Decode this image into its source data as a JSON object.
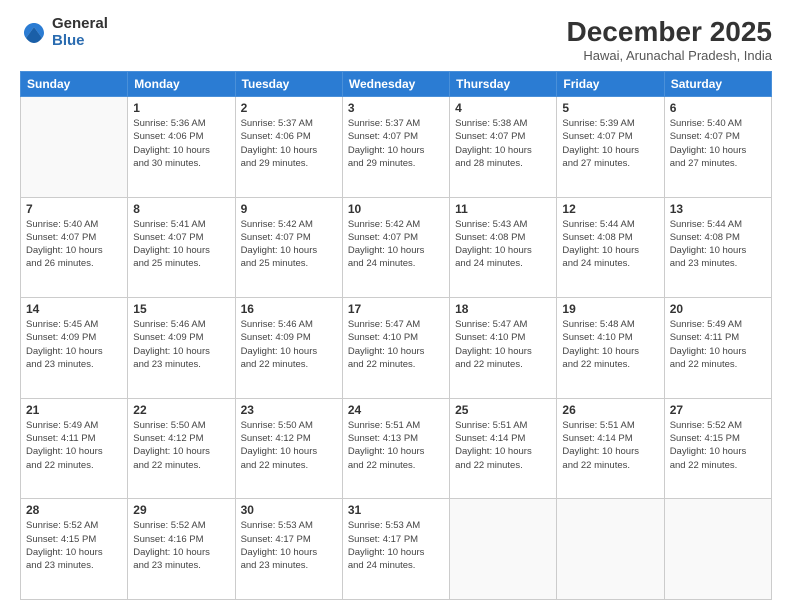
{
  "logo": {
    "general": "General",
    "blue": "Blue"
  },
  "title": "December 2025",
  "location": "Hawai, Arunachal Pradesh, India",
  "days_of_week": [
    "Sunday",
    "Monday",
    "Tuesday",
    "Wednesday",
    "Thursday",
    "Friday",
    "Saturday"
  ],
  "weeks": [
    [
      {
        "day": "",
        "info": ""
      },
      {
        "day": "1",
        "info": "Sunrise: 5:36 AM\nSunset: 4:06 PM\nDaylight: 10 hours\nand 30 minutes."
      },
      {
        "day": "2",
        "info": "Sunrise: 5:37 AM\nSunset: 4:06 PM\nDaylight: 10 hours\nand 29 minutes."
      },
      {
        "day": "3",
        "info": "Sunrise: 5:37 AM\nSunset: 4:07 PM\nDaylight: 10 hours\nand 29 minutes."
      },
      {
        "day": "4",
        "info": "Sunrise: 5:38 AM\nSunset: 4:07 PM\nDaylight: 10 hours\nand 28 minutes."
      },
      {
        "day": "5",
        "info": "Sunrise: 5:39 AM\nSunset: 4:07 PM\nDaylight: 10 hours\nand 27 minutes."
      },
      {
        "day": "6",
        "info": "Sunrise: 5:40 AM\nSunset: 4:07 PM\nDaylight: 10 hours\nand 27 minutes."
      }
    ],
    [
      {
        "day": "7",
        "info": "Sunrise: 5:40 AM\nSunset: 4:07 PM\nDaylight: 10 hours\nand 26 minutes."
      },
      {
        "day": "8",
        "info": "Sunrise: 5:41 AM\nSunset: 4:07 PM\nDaylight: 10 hours\nand 25 minutes."
      },
      {
        "day": "9",
        "info": "Sunrise: 5:42 AM\nSunset: 4:07 PM\nDaylight: 10 hours\nand 25 minutes."
      },
      {
        "day": "10",
        "info": "Sunrise: 5:42 AM\nSunset: 4:07 PM\nDaylight: 10 hours\nand 24 minutes."
      },
      {
        "day": "11",
        "info": "Sunrise: 5:43 AM\nSunset: 4:08 PM\nDaylight: 10 hours\nand 24 minutes."
      },
      {
        "day": "12",
        "info": "Sunrise: 5:44 AM\nSunset: 4:08 PM\nDaylight: 10 hours\nand 24 minutes."
      },
      {
        "day": "13",
        "info": "Sunrise: 5:44 AM\nSunset: 4:08 PM\nDaylight: 10 hours\nand 23 minutes."
      }
    ],
    [
      {
        "day": "14",
        "info": "Sunrise: 5:45 AM\nSunset: 4:09 PM\nDaylight: 10 hours\nand 23 minutes."
      },
      {
        "day": "15",
        "info": "Sunrise: 5:46 AM\nSunset: 4:09 PM\nDaylight: 10 hours\nand 23 minutes."
      },
      {
        "day": "16",
        "info": "Sunrise: 5:46 AM\nSunset: 4:09 PM\nDaylight: 10 hours\nand 22 minutes."
      },
      {
        "day": "17",
        "info": "Sunrise: 5:47 AM\nSunset: 4:10 PM\nDaylight: 10 hours\nand 22 minutes."
      },
      {
        "day": "18",
        "info": "Sunrise: 5:47 AM\nSunset: 4:10 PM\nDaylight: 10 hours\nand 22 minutes."
      },
      {
        "day": "19",
        "info": "Sunrise: 5:48 AM\nSunset: 4:10 PM\nDaylight: 10 hours\nand 22 minutes."
      },
      {
        "day": "20",
        "info": "Sunrise: 5:49 AM\nSunset: 4:11 PM\nDaylight: 10 hours\nand 22 minutes."
      }
    ],
    [
      {
        "day": "21",
        "info": "Sunrise: 5:49 AM\nSunset: 4:11 PM\nDaylight: 10 hours\nand 22 minutes."
      },
      {
        "day": "22",
        "info": "Sunrise: 5:50 AM\nSunset: 4:12 PM\nDaylight: 10 hours\nand 22 minutes."
      },
      {
        "day": "23",
        "info": "Sunrise: 5:50 AM\nSunset: 4:12 PM\nDaylight: 10 hours\nand 22 minutes."
      },
      {
        "day": "24",
        "info": "Sunrise: 5:51 AM\nSunset: 4:13 PM\nDaylight: 10 hours\nand 22 minutes."
      },
      {
        "day": "25",
        "info": "Sunrise: 5:51 AM\nSunset: 4:14 PM\nDaylight: 10 hours\nand 22 minutes."
      },
      {
        "day": "26",
        "info": "Sunrise: 5:51 AM\nSunset: 4:14 PM\nDaylight: 10 hours\nand 22 minutes."
      },
      {
        "day": "27",
        "info": "Sunrise: 5:52 AM\nSunset: 4:15 PM\nDaylight: 10 hours\nand 22 minutes."
      }
    ],
    [
      {
        "day": "28",
        "info": "Sunrise: 5:52 AM\nSunset: 4:15 PM\nDaylight: 10 hours\nand 23 minutes."
      },
      {
        "day": "29",
        "info": "Sunrise: 5:52 AM\nSunset: 4:16 PM\nDaylight: 10 hours\nand 23 minutes."
      },
      {
        "day": "30",
        "info": "Sunrise: 5:53 AM\nSunset: 4:17 PM\nDaylight: 10 hours\nand 23 minutes."
      },
      {
        "day": "31",
        "info": "Sunrise: 5:53 AM\nSunset: 4:17 PM\nDaylight: 10 hours\nand 24 minutes."
      },
      {
        "day": "",
        "info": ""
      },
      {
        "day": "",
        "info": ""
      },
      {
        "day": "",
        "info": ""
      }
    ]
  ]
}
